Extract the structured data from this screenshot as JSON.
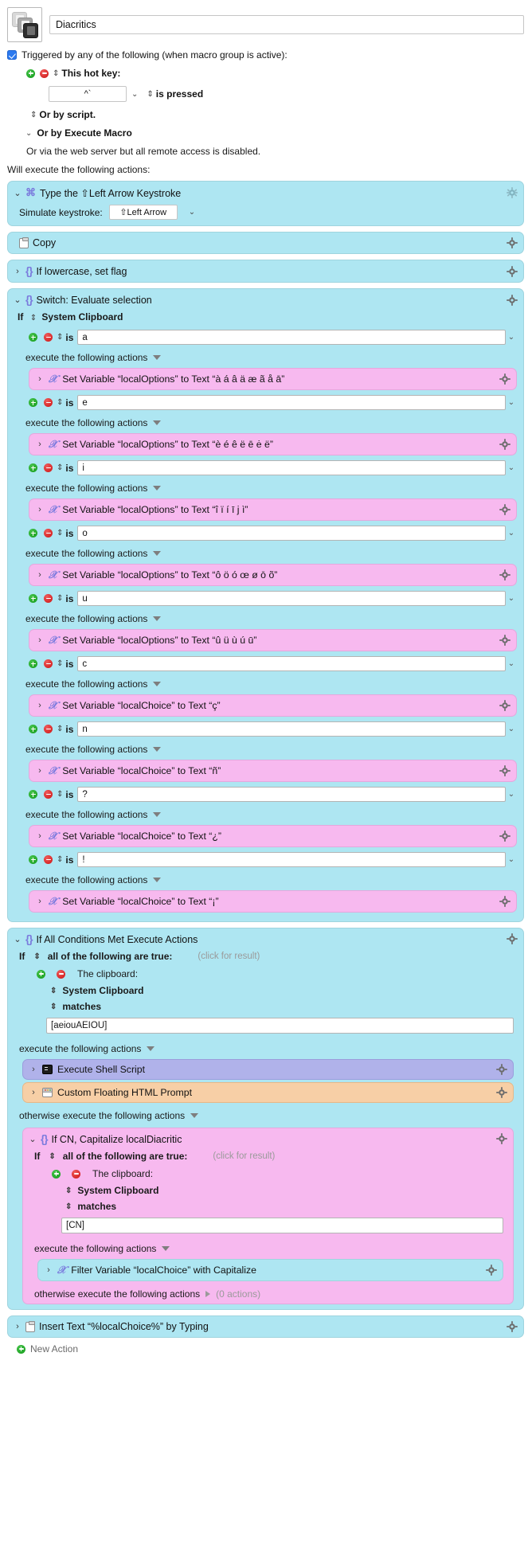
{
  "macro": {
    "icon_name": "keystroke-stack-icon",
    "name": "Diacritics"
  },
  "triggers": {
    "checkbox_label": "Triggered by any of the following (when macro group is active):",
    "hotkey_label": "This hot key:",
    "hotkey_value": "^`",
    "is_pressed_label": "is pressed",
    "or_by_script": "Or by script.",
    "or_by_execute_macro": "Or by Execute Macro",
    "web_server_note": "Or via the web server but all remote access is disabled."
  },
  "actions_header": "Will execute the following actions:",
  "actions": {
    "type_keystroke": {
      "title": "Type the ⇧Left Arrow Keystroke",
      "field_label": "Simulate keystroke:",
      "field_value": "⇧Left Arrow"
    },
    "copy": {
      "title": "Copy"
    },
    "if_lowercase": {
      "title": "If lowercase, set flag"
    },
    "switch": {
      "title": "Switch: Evaluate selection",
      "if_label": "If",
      "source": "System Clipboard",
      "is_label": "is",
      "execute_label": "execute the following actions",
      "cases": [
        {
          "value": "a",
          "action": "Set Variable “localOptions” to Text “à á â ä æ ã å ā”"
        },
        {
          "value": "e",
          "action": "Set Variable “localOptions” to Text “è é ê ë ē ė ë”"
        },
        {
          "value": "i",
          "action": "Set Variable “localOptions” to Text “î ï í ī j ì”"
        },
        {
          "value": "o",
          "action": "Set Variable “localOptions” to Text “ô ö ó œ ø ō õ”"
        },
        {
          "value": "u",
          "action": "Set Variable “localOptions” to Text “û ü ù ú ū”"
        },
        {
          "value": "c",
          "action": "Set Variable “localChoice” to Text “ç”"
        },
        {
          "value": "n",
          "action": "Set Variable “localChoice” to Text “ñ”"
        },
        {
          "value": "?",
          "action": "Set Variable “localChoice” to Text “¿”"
        },
        {
          "value": "!",
          "action": "Set Variable “localChoice” to Text “¡”"
        }
      ]
    },
    "if_all_conditions": {
      "title": "If All Conditions Met Execute Actions",
      "if_label": "If",
      "all_true_label": "all of the following are true:",
      "click_for_result": "(click for result)",
      "clipboard_label": "The clipboard:",
      "source": "System Clipboard",
      "operator": "matches",
      "match_value": "[aeiouAEIOU]",
      "execute_label": "execute the following actions",
      "then_actions": [
        {
          "title": "Execute Shell Script",
          "icon": "terminal-icon",
          "color": "purple"
        },
        {
          "title": "Custom Floating HTML Prompt",
          "icon": "window-icon",
          "color": "orange"
        }
      ],
      "otherwise_label": "otherwise execute the following actions",
      "nested_if": {
        "title": "If CN, Capitalize localDiacritic",
        "if_label": "If",
        "all_true_label": "all of the following are true:",
        "click_for_result": "(click for result)",
        "clipboard_label": "The clipboard:",
        "source": "System Clipboard",
        "operator": "matches",
        "match_value": "[CN]",
        "execute_label": "execute the following actions",
        "then_action": "Filter Variable “localChoice” with Capitalize",
        "otherwise_label": "otherwise execute the following actions",
        "otherwise_count": "(0 actions)"
      }
    },
    "insert_text": {
      "title": "Insert Text “%localChoice%” by Typing"
    }
  },
  "footer": {
    "new_action": "New Action"
  }
}
